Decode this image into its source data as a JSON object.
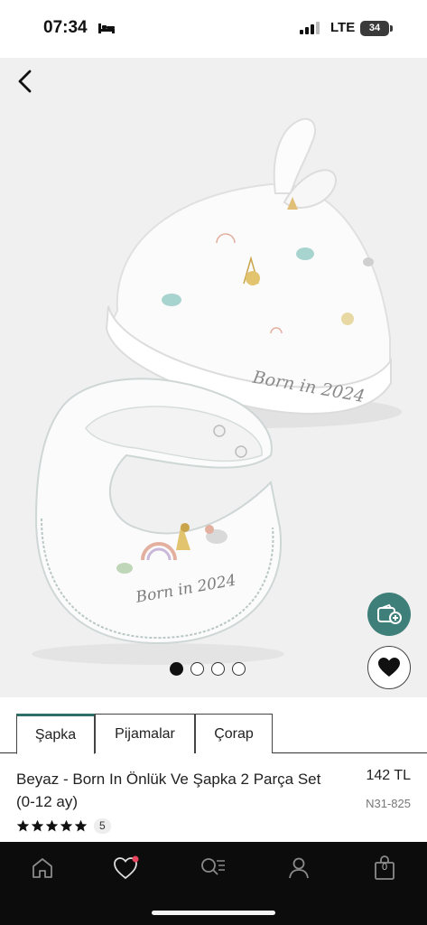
{
  "status_bar": {
    "time": "07:34",
    "network": "LTE",
    "battery": "34",
    "icons": [
      "bed-icon",
      "signal-icon"
    ]
  },
  "gallery": {
    "back_icon": "chevron-left-icon",
    "hat_embroidery": "Born in 2024",
    "bib_embroidery": "Born in 2024",
    "dots_total": 4,
    "active_dot": 1,
    "wallet_icon": "wallet-plus-icon",
    "favorite_icon": "heart-icon",
    "wallet_color": "#3f7f7a"
  },
  "tabs": [
    {
      "label": "Şapka",
      "active": true
    },
    {
      "label": "Pijamalar",
      "active": false
    },
    {
      "label": "Çorap",
      "active": false
    }
  ],
  "product": {
    "name": "Beyaz - Born In Önlük Ve Şapka 2 Parça Set (0-12 ay)",
    "price": "142 TL",
    "code": "N31-825",
    "rating_stars": 5,
    "rating_count": "5"
  },
  "bottom_nav": {
    "items": [
      "home-icon",
      "heart-icon",
      "search-icon",
      "account-icon",
      "bag-icon"
    ],
    "cart_count": "0",
    "notification_color": "#e8455f"
  }
}
